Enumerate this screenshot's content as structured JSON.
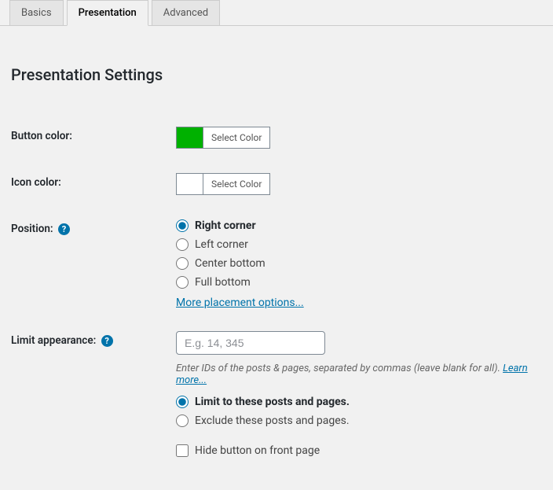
{
  "tabs": {
    "basics": "Basics",
    "presentation": "Presentation",
    "advanced": "Advanced",
    "active": "presentation"
  },
  "heading": "Presentation Settings",
  "fields": {
    "button_color": {
      "label": "Button color:",
      "action": "Select Color",
      "value": "#00b100"
    },
    "icon_color": {
      "label": "Icon color:",
      "action": "Select Color",
      "value": "#ffffff"
    },
    "position": {
      "label": "Position:",
      "options": {
        "right": "Right corner",
        "left": "Left corner",
        "center": "Center bottom",
        "full": "Full bottom"
      },
      "selected": "right",
      "more_link": "More placement options..."
    },
    "limit": {
      "label": "Limit appearance:",
      "placeholder": "E.g. 14, 345",
      "description": "Enter IDs of the posts & pages, separated by commas (leave blank for all). ",
      "learn_more": "Learn more...",
      "options": {
        "limit": "Limit to these posts and pages.",
        "exclude": "Exclude these posts and pages."
      },
      "selected": "limit",
      "hide_front": "Hide button on front page"
    }
  }
}
